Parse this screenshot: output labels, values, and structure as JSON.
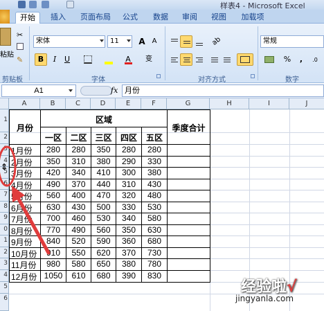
{
  "window": {
    "title": "样表4 - Microsoft Excel"
  },
  "tabs": [
    "开始",
    "插入",
    "页面布局",
    "公式",
    "数据",
    "审阅",
    "视图",
    "加载项"
  ],
  "ribbon": {
    "clipboard": {
      "paste_label": "粘贴",
      "group_label": "剪贴板"
    },
    "font": {
      "font_name": "宋体",
      "font_size": "11",
      "group_label": "字体",
      "grow": "A",
      "shrink": "A",
      "bold": "B",
      "italic": "I",
      "underline": "U",
      "phonetic": "变"
    },
    "alignment": {
      "group_label": "对齐方式"
    },
    "number": {
      "format": "常规",
      "group_label": "数字",
      "percent": "%",
      "comma": ","
    }
  },
  "formula_bar": {
    "name_box": "A1",
    "fx": "fx",
    "content": "月份"
  },
  "columns": [
    "A",
    "B",
    "C",
    "D",
    "E",
    "F",
    "G",
    "H",
    "I",
    "J"
  ],
  "rows": [
    "1",
    "2",
    "3",
    "4",
    "5",
    "6",
    "7",
    "8",
    "9",
    "0",
    "1",
    "2",
    "3",
    "4",
    "5",
    "6"
  ],
  "sheet": {
    "month_header": "月份",
    "region_header": "区域",
    "quarter_header": "季度合计",
    "districts": [
      "一区",
      "二区",
      "三区",
      "四区",
      "五区"
    ],
    "data": [
      {
        "month": "1月份",
        "values": [
          "280",
          "280",
          "350",
          "280",
          "280"
        ]
      },
      {
        "month": "2月份",
        "values": [
          "350",
          "310",
          "380",
          "290",
          "330"
        ]
      },
      {
        "month": "3月份",
        "values": [
          "420",
          "340",
          "410",
          "300",
          "380"
        ]
      },
      {
        "month": "4月份",
        "values": [
          "490",
          "370",
          "440",
          "310",
          "430"
        ]
      },
      {
        "month": "5月份",
        "values": [
          "560",
          "400",
          "470",
          "320",
          "480"
        ]
      },
      {
        "month": "6月份",
        "values": [
          "630",
          "430",
          "500",
          "330",
          "530"
        ]
      },
      {
        "month": "7月份",
        "values": [
          "700",
          "460",
          "530",
          "340",
          "580"
        ]
      },
      {
        "month": "8月份",
        "values": [
          "770",
          "490",
          "560",
          "350",
          "630"
        ]
      },
      {
        "month": "9月份",
        "values": [
          "840",
          "520",
          "590",
          "360",
          "680"
        ]
      },
      {
        "month": "10月份",
        "values": [
          "910",
          "550",
          "620",
          "370",
          "730"
        ]
      },
      {
        "month": "11月份",
        "values": [
          "980",
          "580",
          "650",
          "380",
          "780"
        ]
      },
      {
        "month": "12月份",
        "values": [
          "1050",
          "610",
          "680",
          "390",
          "830"
        ]
      }
    ]
  },
  "watermark": {
    "brand": "经验啦",
    "check": "√",
    "url": "jingyanla.com"
  },
  "colors": {
    "ribbon_bg": "#d3e3f6",
    "annotation": "#e03c3c",
    "header_bg": "#e4ecf7"
  }
}
